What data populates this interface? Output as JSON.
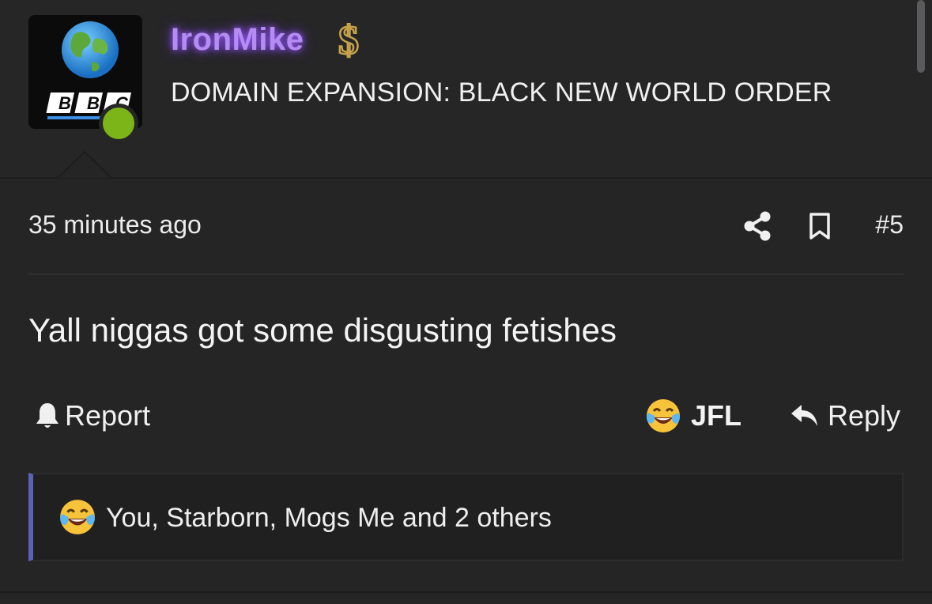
{
  "post": {
    "author": {
      "username": "IronMike",
      "title": "DOMAIN EXPANSION: BLACK NEW WORLD ORDER",
      "avatar_logo_text": "BBC",
      "badge_icon": "dollar-badge-icon",
      "online": true
    },
    "timestamp": "35 minutes ago",
    "number": "#5",
    "body": "Yall niggas got some disgusting fetishes",
    "actions": {
      "report_label": "Report",
      "reaction_label": "JFL",
      "reply_label": "Reply"
    },
    "reactions_summary": "You, Starborn, Mogs Me and 2 others"
  },
  "colors": {
    "background": "#252526",
    "username": "#b48cf2",
    "online": "#7cb518",
    "reaction_accent": "#5b63b7"
  }
}
